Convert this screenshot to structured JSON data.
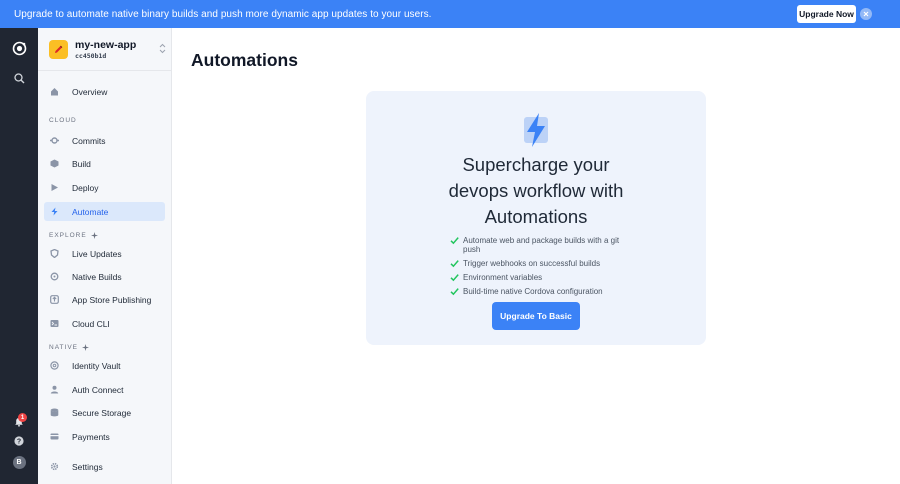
{
  "banner": {
    "text": "Upgrade to automate native binary builds and push more dynamic app updates to your users.",
    "button_label": "Upgrade Now"
  },
  "rail": {
    "notification_count": "1",
    "avatar_initial": "B"
  },
  "app": {
    "name": "my-new-app",
    "id": "cc450b1d"
  },
  "sidebar": {
    "overview": "Overview",
    "cloud_section": "CLOUD",
    "cloud_items": [
      {
        "label": "Commits",
        "icon": "commit-icon"
      },
      {
        "label": "Build",
        "icon": "cube-icon"
      },
      {
        "label": "Deploy",
        "icon": "play-icon"
      },
      {
        "label": "Automate",
        "icon": "bolt-icon",
        "active": true
      }
    ],
    "explore_section": "EXPLORE",
    "explore_items": [
      {
        "label": "Live Updates",
        "icon": "shield-icon"
      },
      {
        "label": "Native Builds",
        "icon": "cog-icon"
      },
      {
        "label": "App Store Publishing",
        "icon": "publish-icon"
      },
      {
        "label": "Cloud CLI",
        "icon": "terminal-icon"
      }
    ],
    "native_section": "NATIVE",
    "native_items": [
      {
        "label": "Identity Vault",
        "icon": "vault-icon"
      },
      {
        "label": "Auth Connect",
        "icon": "user-icon"
      },
      {
        "label": "Secure Storage",
        "icon": "database-icon"
      },
      {
        "label": "Payments",
        "icon": "card-icon"
      }
    ],
    "settings": "Settings"
  },
  "main": {
    "title": "Automations",
    "card": {
      "heading_lines": [
        "Supercharge your",
        "devops workflow with",
        "Automations"
      ],
      "features": [
        "Automate web and package builds with a git push",
        "Trigger webhooks on successful builds",
        "Environment variables",
        "Build-time native Cordova configuration"
      ],
      "cta_label": "Upgrade To Basic"
    }
  },
  "colors": {
    "accent": "#3b82f6",
    "rail_bg": "#202632",
    "sidebar_bg": "#f5f7fa",
    "card_bg": "#eef3fc",
    "check": "#22c55e"
  }
}
